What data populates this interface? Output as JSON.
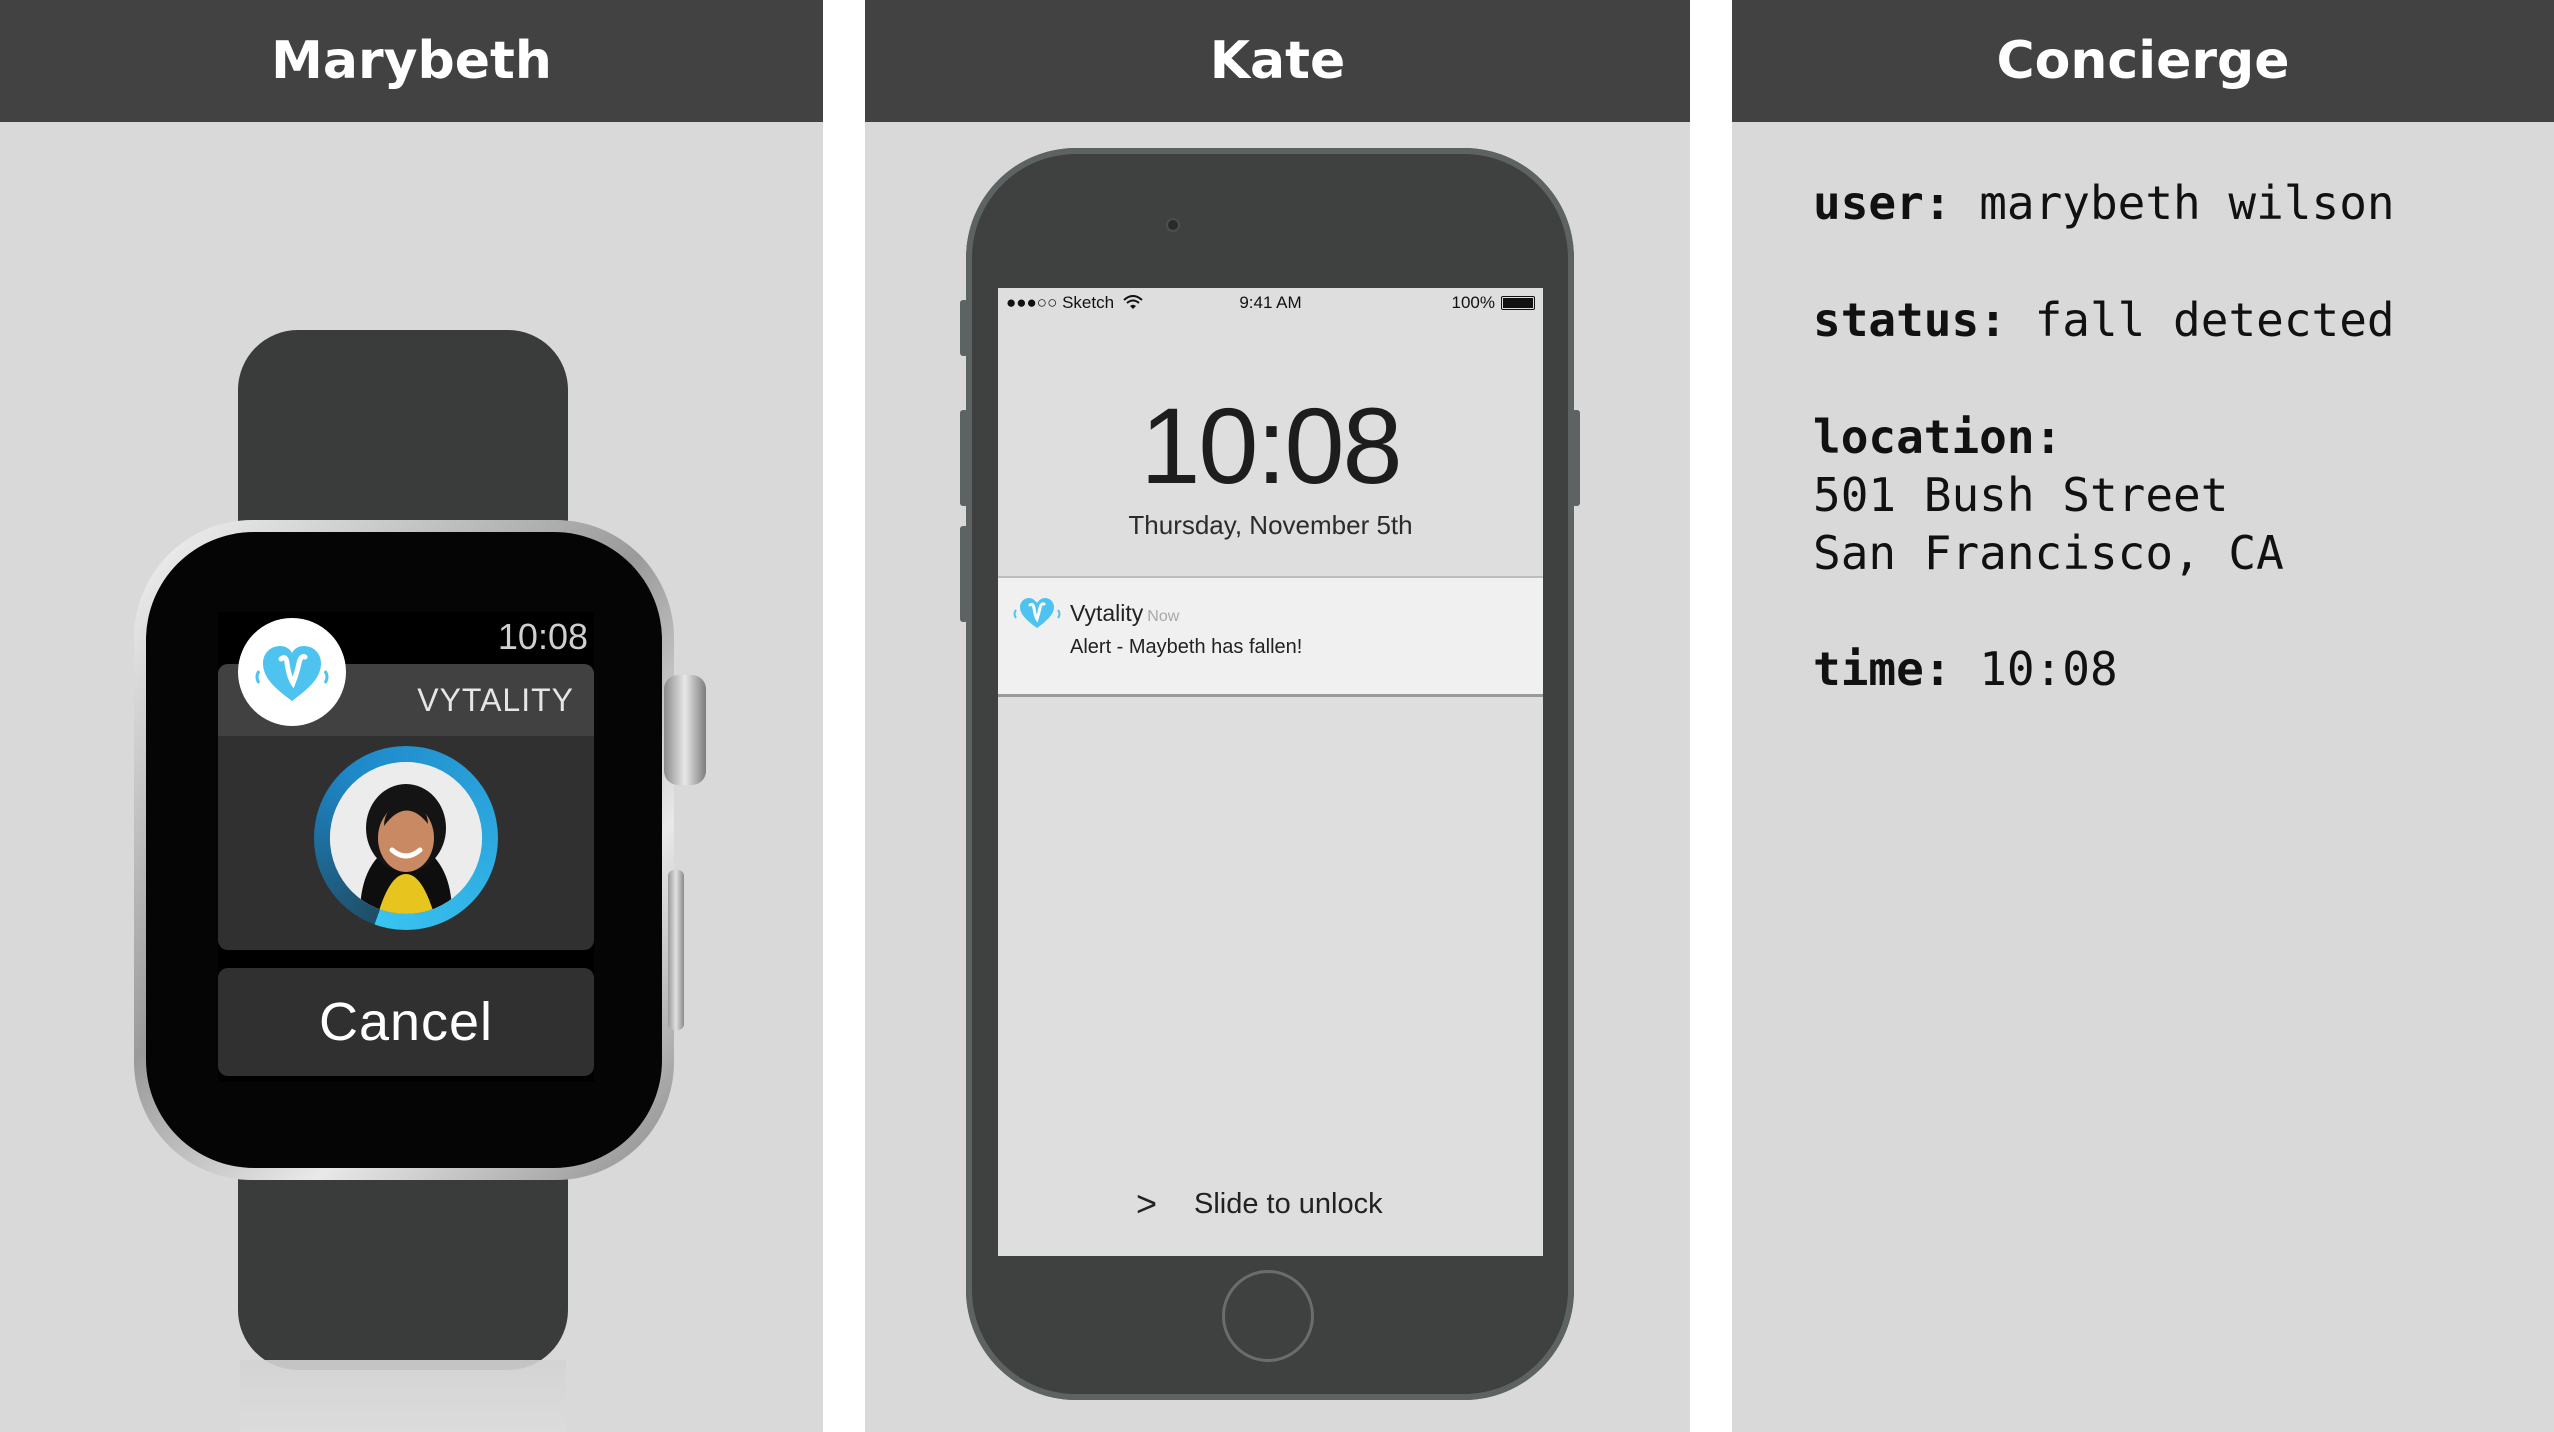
{
  "panels": {
    "watch": {
      "title": "Marybeth",
      "time": "10:08",
      "app_name": "VYTALITY",
      "cancel_label": "Cancel",
      "app_icon": "vytality-heart-icon"
    },
    "phone": {
      "title": "Kate",
      "status_bar": {
        "carrier": "●●●○○ Sketch",
        "time": "9:41 AM",
        "battery": "100%"
      },
      "lock_time": "10:08",
      "lock_date": "Thursday, November 5th",
      "notification": {
        "app": "Vytality",
        "when": "Now",
        "message": "Alert - Maybeth has fallen!"
      },
      "slide_chevron": ">",
      "slide_label": "Slide to unlock"
    },
    "concierge": {
      "title": "Concierge",
      "user_label": "user:",
      "user_value": "marybeth wilson",
      "status_label": "status:",
      "status_value": "fall detected",
      "location_label": "location:",
      "location_line1": "501 Bush Street",
      "location_line2": "San Francisco, CA",
      "time_label": "time:",
      "time_value": "10:08"
    }
  },
  "colors": {
    "header_bg": "#424242",
    "panel_bg": "#d9d9d9",
    "accent_blue": "#39c4f1"
  }
}
